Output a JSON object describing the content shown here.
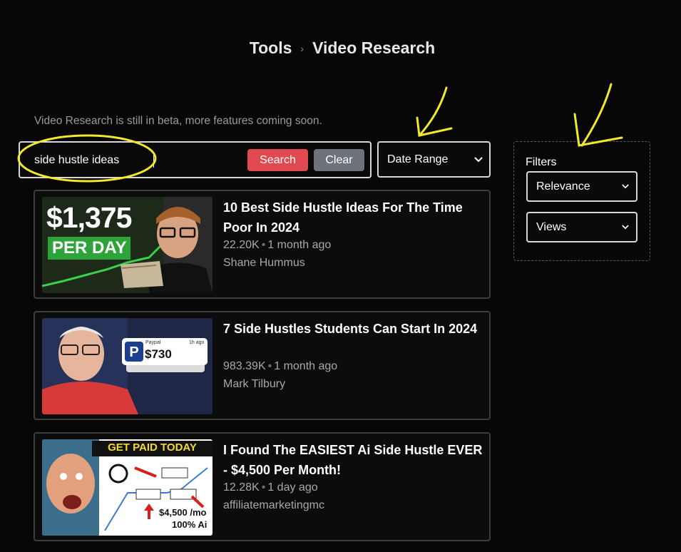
{
  "breadcrumb": {
    "root": "Tools",
    "current": "Video Research"
  },
  "beta_note": "Video Research is still in beta, more features coming soon.",
  "search": {
    "value": "side hustle ideas",
    "search_label": "Search",
    "clear_label": "Clear"
  },
  "date_range": {
    "selected": "Date Range"
  },
  "filters": {
    "title": "Filters",
    "sort": "Relevance",
    "metric": "Views"
  },
  "results": [
    {
      "title": "10 Best Side Hustle Ideas For The Time Poor In 2024",
      "views": "22.20K",
      "age": "1 month ago",
      "channel": "Shane Hummus",
      "thumb": {
        "line1": "$1,375",
        "line2": "PER DAY"
      }
    },
    {
      "title": "7 Side Hustles Students Can Start In 2024",
      "views": "983.39K",
      "age": "1 month ago",
      "channel": "Mark Tilbury",
      "thumb": {
        "app": "Paypal",
        "time": "1h ago",
        "amount": "$730"
      }
    },
    {
      "title": "I Found The EASIEST Ai Side Hustle EVER - $4,500 Per Month!",
      "views": "12.28K",
      "age": "1 day ago",
      "channel": "affiliatemarketingmc",
      "thumb": {
        "banner": "GET PAID TODAY",
        "amount": "$4,500 /mo",
        "sub": "100% Ai"
      }
    }
  ],
  "colors": {
    "background": "#070707",
    "search_button": "#e0494f",
    "clear_button": "#6d737c",
    "annotation": "#f2e92a"
  }
}
